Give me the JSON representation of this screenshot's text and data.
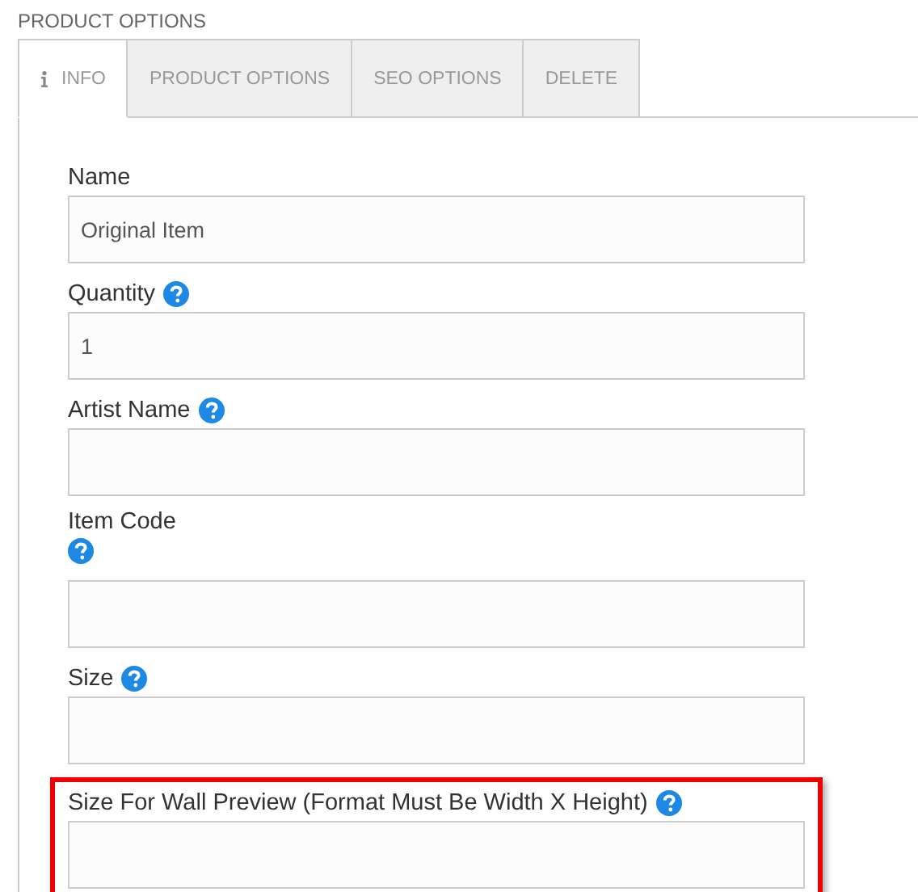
{
  "section_title": "PRODUCT OPTIONS",
  "tabs": [
    {
      "label": "INFO",
      "selected": true,
      "has_icon": true
    },
    {
      "label": "PRODUCT OPTIONS",
      "selected": false,
      "has_icon": false
    },
    {
      "label": "SEO OPTIONS",
      "selected": false,
      "has_icon": false
    },
    {
      "label": "DELETE",
      "selected": false,
      "has_icon": false
    }
  ],
  "fields": [
    {
      "label": "Name",
      "value": "Original Item",
      "help": false,
      "help_below": false,
      "highlighted": false
    },
    {
      "label": "Quantity",
      "value": "1",
      "help": true,
      "help_below": false,
      "highlighted": false
    },
    {
      "label": "Artist Name",
      "help": true,
      "help_below": false,
      "highlighted": false
    },
    {
      "label": "Item Code",
      "help": true,
      "help_below": true,
      "highlighted": false
    },
    {
      "label": "Size",
      "help": true,
      "help_below": false,
      "highlighted": false
    },
    {
      "label": "Size For Wall Preview (Format Must Be Width X Height)",
      "help": true,
      "help_below": false,
      "highlighted": true
    }
  ]
}
